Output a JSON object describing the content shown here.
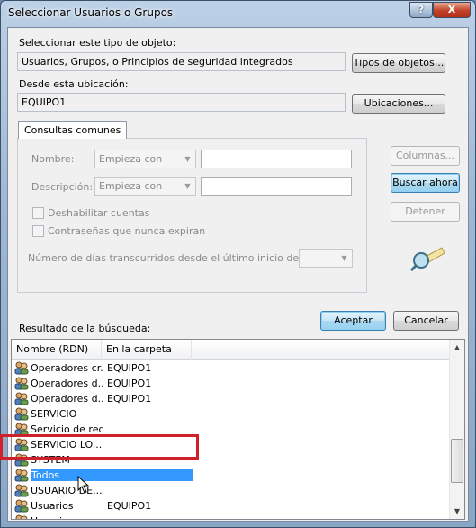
{
  "window": {
    "title": "Seleccionar Usuarios o Grupos"
  },
  "titlebar_buttons": {
    "help": "?",
    "close": "X"
  },
  "object_type": {
    "label": "Seleccionar este tipo de objeto:",
    "value": "Usuarios, Grupos, o Principios de seguridad integrados",
    "button": "Tipos de objetos..."
  },
  "location": {
    "label": "Desde esta ubicación:",
    "value": "EQUIPO1",
    "button": "Ubicaciones..."
  },
  "queries": {
    "tab": "Consultas comunes",
    "name_label": "Nombre:",
    "name_combo": "Empieza con",
    "description_label": "Descripción:",
    "description_combo": "Empieza con",
    "disabled_accounts": "Deshabilitar cuentas",
    "non_expiring": "Contraseñas que nunca expiran",
    "days_label": "Número de días transcurridos desde el último inicio de sesión:"
  },
  "side_buttons": {
    "columns": "Columnas...",
    "search": "Buscar ahora",
    "stop": "Detener"
  },
  "results": {
    "label": "Resultado de la búsqueda:",
    "ok": "Aceptar",
    "cancel": "Cancelar",
    "columns": [
      "Nombre (RDN)",
      "En la carpeta"
    ],
    "rows": [
      {
        "name": "Operadores cr...",
        "folder": "EQUIPO1"
      },
      {
        "name": "Operadores d...",
        "folder": "EQUIPO1"
      },
      {
        "name": "Operadores d...",
        "folder": "EQUIPO1"
      },
      {
        "name": "SERVICIO",
        "folder": ""
      },
      {
        "name": "Servicio de red",
        "folder": ""
      },
      {
        "name": "SERVICIO LO...",
        "folder": ""
      },
      {
        "name": "SYSTEM",
        "folder": ""
      },
      {
        "name": "Todos",
        "folder": "",
        "selected": true
      },
      {
        "name": "USUARIO DE...",
        "folder": ""
      },
      {
        "name": "Usuarios",
        "folder": "EQUIPO1"
      },
      {
        "name": "Usuarios a...",
        "folder": ""
      }
    ]
  },
  "colors": {
    "selection": "#3399ff",
    "highlight_box": "#d0202a"
  }
}
